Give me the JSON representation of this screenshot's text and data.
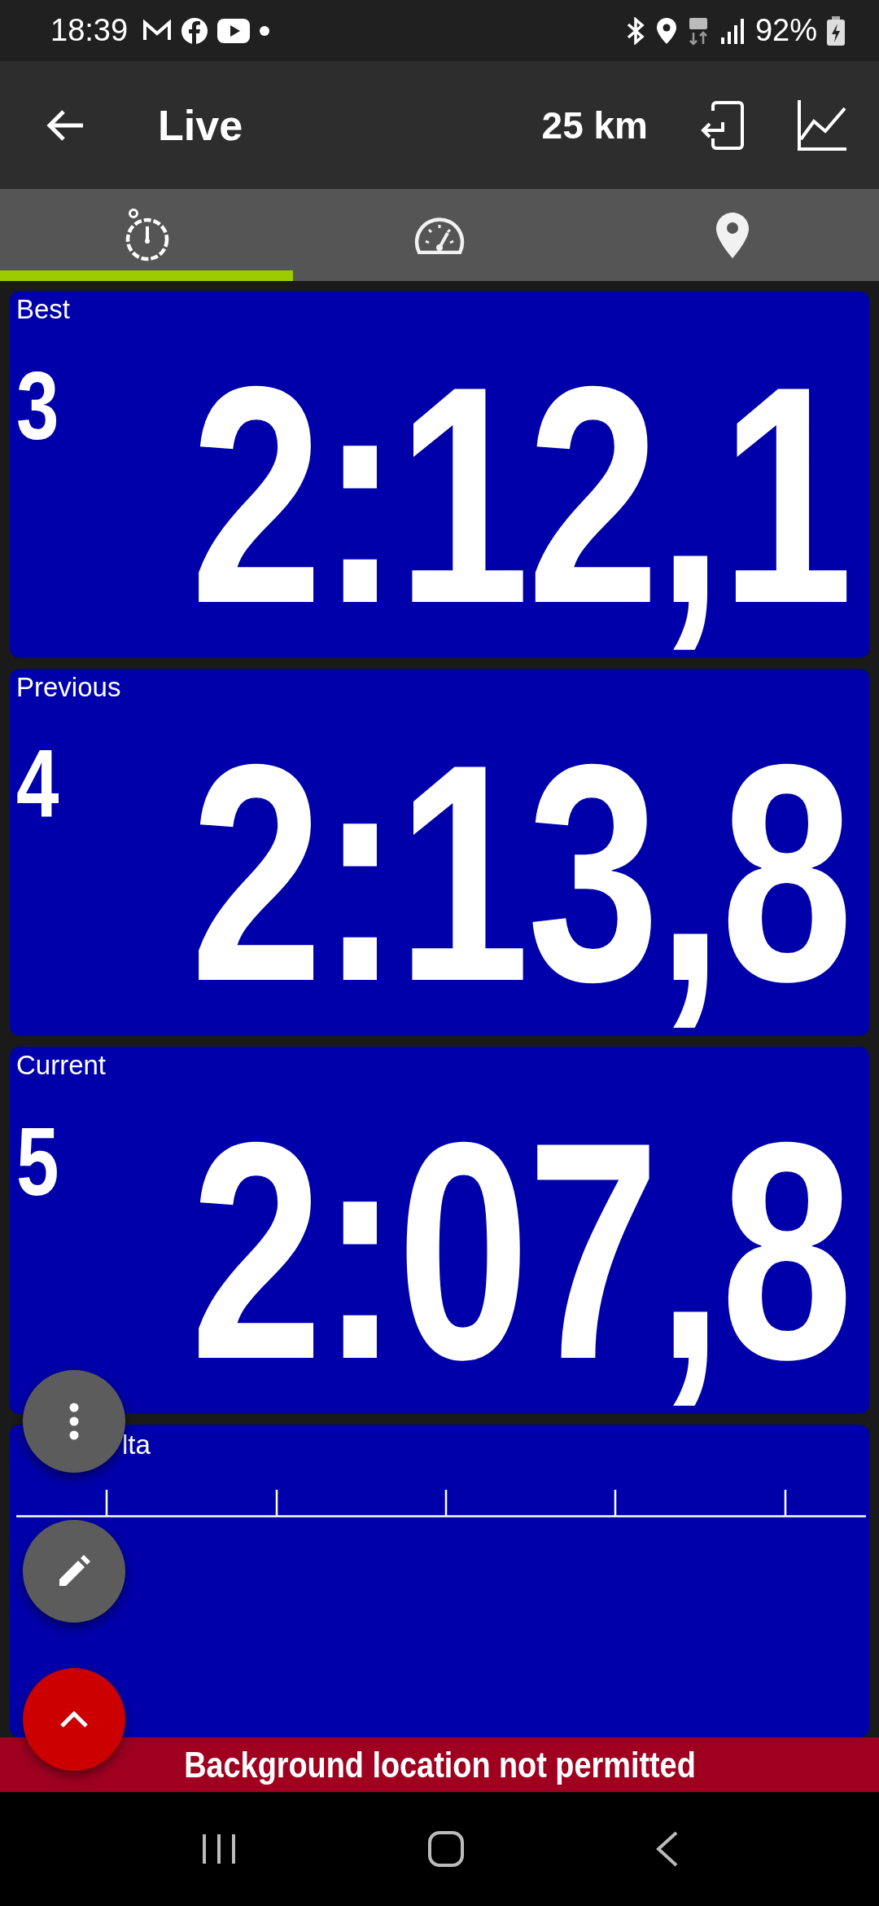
{
  "status_bar": {
    "time": "18:39",
    "battery": "92%"
  },
  "toolbar": {
    "title": "Live",
    "distance": "25 km"
  },
  "tabs": [
    {
      "kind": "stopwatch",
      "selected": true
    },
    {
      "kind": "speedometer",
      "selected": false
    },
    {
      "kind": "location",
      "selected": false
    }
  ],
  "laps": [
    {
      "label": "Best",
      "lap": "3",
      "time": "2:12,1"
    },
    {
      "label": "Previous",
      "lap": "4",
      "time": "2:13,8"
    },
    {
      "label": "Current",
      "lap": "5",
      "time": "2:07,8"
    }
  ],
  "delta_panel": {
    "label": "lta"
  },
  "banner": "Background location not permitted"
}
